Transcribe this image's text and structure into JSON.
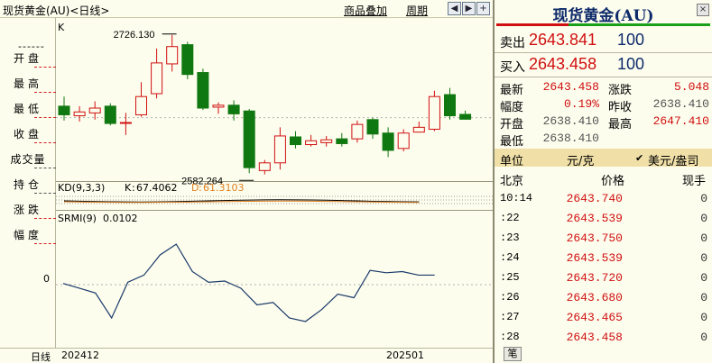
{
  "topbar": {
    "title": "现货黄金(AU)<日线>",
    "links": [
      "商品叠加",
      "周期"
    ],
    "nav": [
      "◀",
      "▶",
      "+",
      "−"
    ]
  },
  "leftpanel": {
    "top_dashes": "------",
    "items": [
      {
        "label": "开盘",
        "dash": "red"
      },
      {
        "label": "最高",
        "dash": "red"
      },
      {
        "label": "最低",
        "dash": "red"
      },
      {
        "label": "收盘",
        "dash": "red"
      },
      {
        "label": "成交量",
        "dash": "black"
      },
      {
        "label": "持仓",
        "dash": "black"
      },
      {
        "label": "涨跌",
        "dash": "red"
      },
      {
        "label": "幅度",
        "dash": "red"
      }
    ]
  },
  "bottombar": {
    "period": "日线",
    "dates": [
      "202412",
      "202501"
    ]
  },
  "chart_data": [
    {
      "type": "candlestick",
      "panel": "K",
      "title": "K",
      "annotations": [
        {
          "text": "2726.130",
          "bar_index": 6,
          "value": 2726.13
        },
        {
          "text": "2582.264",
          "bar_index": 11,
          "value": 2582.264
        }
      ],
      "ohlc": [
        {
          "o": 2652,
          "h": 2662,
          "l": 2637,
          "c": 2643
        },
        {
          "o": 2642,
          "h": 2652,
          "l": 2636,
          "c": 2646
        },
        {
          "o": 2645,
          "h": 2657,
          "l": 2638,
          "c": 2650
        },
        {
          "o": 2652,
          "h": 2655,
          "l": 2632,
          "c": 2634
        },
        {
          "o": 2635,
          "h": 2645,
          "l": 2622,
          "c": 2635
        },
        {
          "o": 2643,
          "h": 2677,
          "l": 2641,
          "c": 2662
        },
        {
          "o": 2665,
          "h": 2712,
          "l": 2660,
          "c": 2697
        },
        {
          "o": 2696,
          "h": 2726.13,
          "l": 2688,
          "c": 2714
        },
        {
          "o": 2716,
          "h": 2719,
          "l": 2680,
          "c": 2685
        },
        {
          "o": 2687,
          "h": 2691,
          "l": 2648,
          "c": 2650
        },
        {
          "o": 2651,
          "h": 2656,
          "l": 2644,
          "c": 2653
        },
        {
          "o": 2653,
          "h": 2658,
          "l": 2637,
          "c": 2644
        },
        {
          "o": 2647,
          "h": 2649,
          "l": 2582.264,
          "c": 2588
        },
        {
          "o": 2585,
          "h": 2596,
          "l": 2581,
          "c": 2593
        },
        {
          "o": 2593,
          "h": 2630,
          "l": 2586,
          "c": 2621
        },
        {
          "o": 2620,
          "h": 2626,
          "l": 2608,
          "c": 2612
        },
        {
          "o": 2612,
          "h": 2622,
          "l": 2610,
          "c": 2616
        },
        {
          "o": 2614,
          "h": 2621,
          "l": 2610,
          "c": 2617
        },
        {
          "o": 2618,
          "h": 2624,
          "l": 2610,
          "c": 2613
        },
        {
          "o": 2618,
          "h": 2637,
          "l": 2614,
          "c": 2633
        },
        {
          "o": 2638,
          "h": 2640,
          "l": 2618,
          "c": 2623
        },
        {
          "o": 2624,
          "h": 2630,
          "l": 2599,
          "c": 2606
        },
        {
          "o": 2608,
          "h": 2628,
          "l": 2605,
          "c": 2624
        },
        {
          "o": 2625,
          "h": 2636,
          "l": 2625,
          "c": 2630
        },
        {
          "o": 2628,
          "h": 2668,
          "l": 2626,
          "c": 2662
        },
        {
          "o": 2664,
          "h": 2671,
          "l": 2638,
          "c": 2642
        },
        {
          "o": 2643.458,
          "h": 2647.41,
          "l": 2638.41,
          "c": 2638.41
        }
      ]
    },
    {
      "type": "line",
      "panel": "KD",
      "title": "KD(9,3,3)",
      "series": [
        {
          "name": "K",
          "last": "67.4062",
          "color": "#000000"
        },
        {
          "name": "D",
          "last": "61.3103",
          "color": "#e08020"
        }
      ]
    },
    {
      "type": "line",
      "panel": "SRMI",
      "title": "SRMI(9)",
      "last": "0.0102",
      "yticks": [
        "0"
      ],
      "ylim": [
        -0.05,
        0.05
      ],
      "values": [
        0.001,
        -0.003,
        -0.007,
        -0.028,
        0.002,
        0.008,
        0.025,
        0.034,
        0.011,
        0.002,
        0.003,
        -0.003,
        -0.017,
        -0.015,
        -0.028,
        -0.031,
        -0.021,
        -0.008,
        -0.011,
        0.012,
        0.01,
        0.011,
        0.008,
        0.008
      ]
    }
  ],
  "rightpanel": {
    "title": "现货黄金(AU)",
    "close": "×",
    "sell": {
      "label": "卖出",
      "price": "2643.841",
      "qty": "100"
    },
    "buy": {
      "label": "买入",
      "price": "2643.458",
      "qty": "100"
    },
    "stats": [
      {
        "k1": "最新",
        "v1": "2643.458",
        "c1": "red",
        "k2": "涨跌",
        "v2": "5.048",
        "c2": "red"
      },
      {
        "k1": "幅度",
        "v1": "0.19%",
        "c1": "red",
        "k2": "昨收",
        "v2": "2638.410",
        "c2": "gray"
      },
      {
        "k1": "开盘",
        "v1": "2638.410",
        "c1": "gray",
        "k2": "最高",
        "v2": "2647.410",
        "c2": "red"
      },
      {
        "k1": "最低",
        "v1": "2638.410",
        "c1": "gray",
        "k2": "",
        "v2": "",
        "c2": "gray"
      }
    ],
    "unit": {
      "label": "单位",
      "value": "元/克",
      "check": "✔",
      "alt": "美元/盎司"
    },
    "ticks_header": {
      "place": "北京",
      "price": "价格",
      "vol": "现手"
    },
    "ticks": [
      {
        "time": "10:14",
        "price": "2643.740",
        "vol": "0"
      },
      {
        "time": ":22",
        "price": "2643.539",
        "vol": "0"
      },
      {
        "time": ":23",
        "price": "2643.750",
        "vol": "0"
      },
      {
        "time": ":24",
        "price": "2643.539",
        "vol": "0"
      },
      {
        "time": ":25",
        "price": "2643.720",
        "vol": "0"
      },
      {
        "time": ":26",
        "price": "2643.680",
        "vol": "0"
      },
      {
        "time": ":27",
        "price": "2643.465",
        "vol": "0"
      },
      {
        "time": ":28",
        "price": "2643.458",
        "vol": "0"
      }
    ],
    "tab": "笔"
  }
}
